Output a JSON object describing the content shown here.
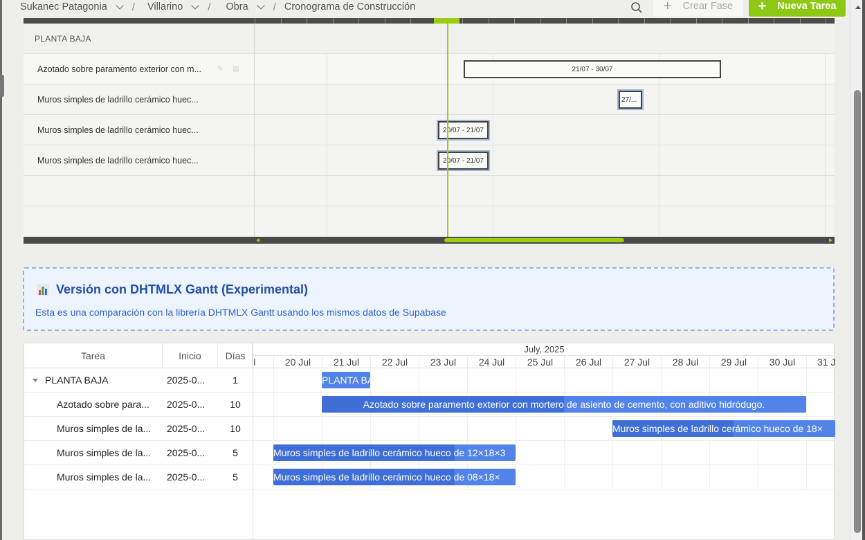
{
  "breadcrumb": {
    "items": [
      {
        "label": "Sukanec Patagonia"
      },
      {
        "label": "Villarino"
      },
      {
        "label": "Obra"
      },
      {
        "label": "Cronograma de Construcción"
      }
    ]
  },
  "toolbar": {
    "crear_fase": "Crear Fase",
    "nueva_tarea": "Nueva Tarea",
    "plus_glyph": "+"
  },
  "legacy_gantt": {
    "phase_label": "PLANTA BAJA",
    "rows": [
      {
        "label": "Azotado sobre paramento exterior con m...",
        "bar": "21/07 - 30/07"
      },
      {
        "label": "Muros simples de ladrillo cerámico huec...",
        "bar": "27/..."
      },
      {
        "label": "Muros simples de ladrillo cerámico huec...",
        "bar": "20/07 - 21/07"
      },
      {
        "label": "Muros simples de ladrillo cerámico huec...",
        "bar": "20/07 - 21/07"
      }
    ],
    "accent_color": "#9ccc13"
  },
  "info": {
    "title": "Versión con DHTMLX Gantt (Experimental)",
    "description": "Esta es una comparación con la librería DHTMLX Gantt usando los mismos datos de Supabase",
    "icon": "bar-chart-icon"
  },
  "dhtmlx": {
    "headers": {
      "tarea": "Tarea",
      "inicio": "Inicio",
      "dias": "Días"
    },
    "month": "July, 2025",
    "days": [
      "Jul",
      "20 Jul",
      "21 Jul",
      "22 Jul",
      "23 Jul",
      "24 Jul",
      "25 Jul",
      "26 Jul",
      "27 Jul",
      "28 Jul",
      "29 Jul",
      "30 Jul",
      "31 J"
    ],
    "rows": [
      {
        "tarea": "PLANTA BAJA",
        "inicio": "2025-0...",
        "dias": "1",
        "bar": "PLANTA BA"
      },
      {
        "tarea": "Azotado sobre para...",
        "inicio": "2025-0...",
        "dias": "10",
        "bar": "Azotado sobre paramento exterior con mortero de asiento de cemento, con aditivo hidródugo."
      },
      {
        "tarea": "Muros simples de la...",
        "inicio": "2025-0...",
        "dias": "10",
        "bar": "Muros simples de ladrillo cerámico hueco de 18×"
      },
      {
        "tarea": "Muros simples de la...",
        "inicio": "2025-0...",
        "dias": "5",
        "bar": "Muros simples de ladrillo cerámico hueco de 12×18×3"
      },
      {
        "tarea": "Muros simples de la...",
        "inicio": "2025-0...",
        "dias": "5",
        "bar": "Muros simples de ladrillo cerámico hueco de 08×18×"
      }
    ],
    "bar_color": "#5283e8"
  }
}
